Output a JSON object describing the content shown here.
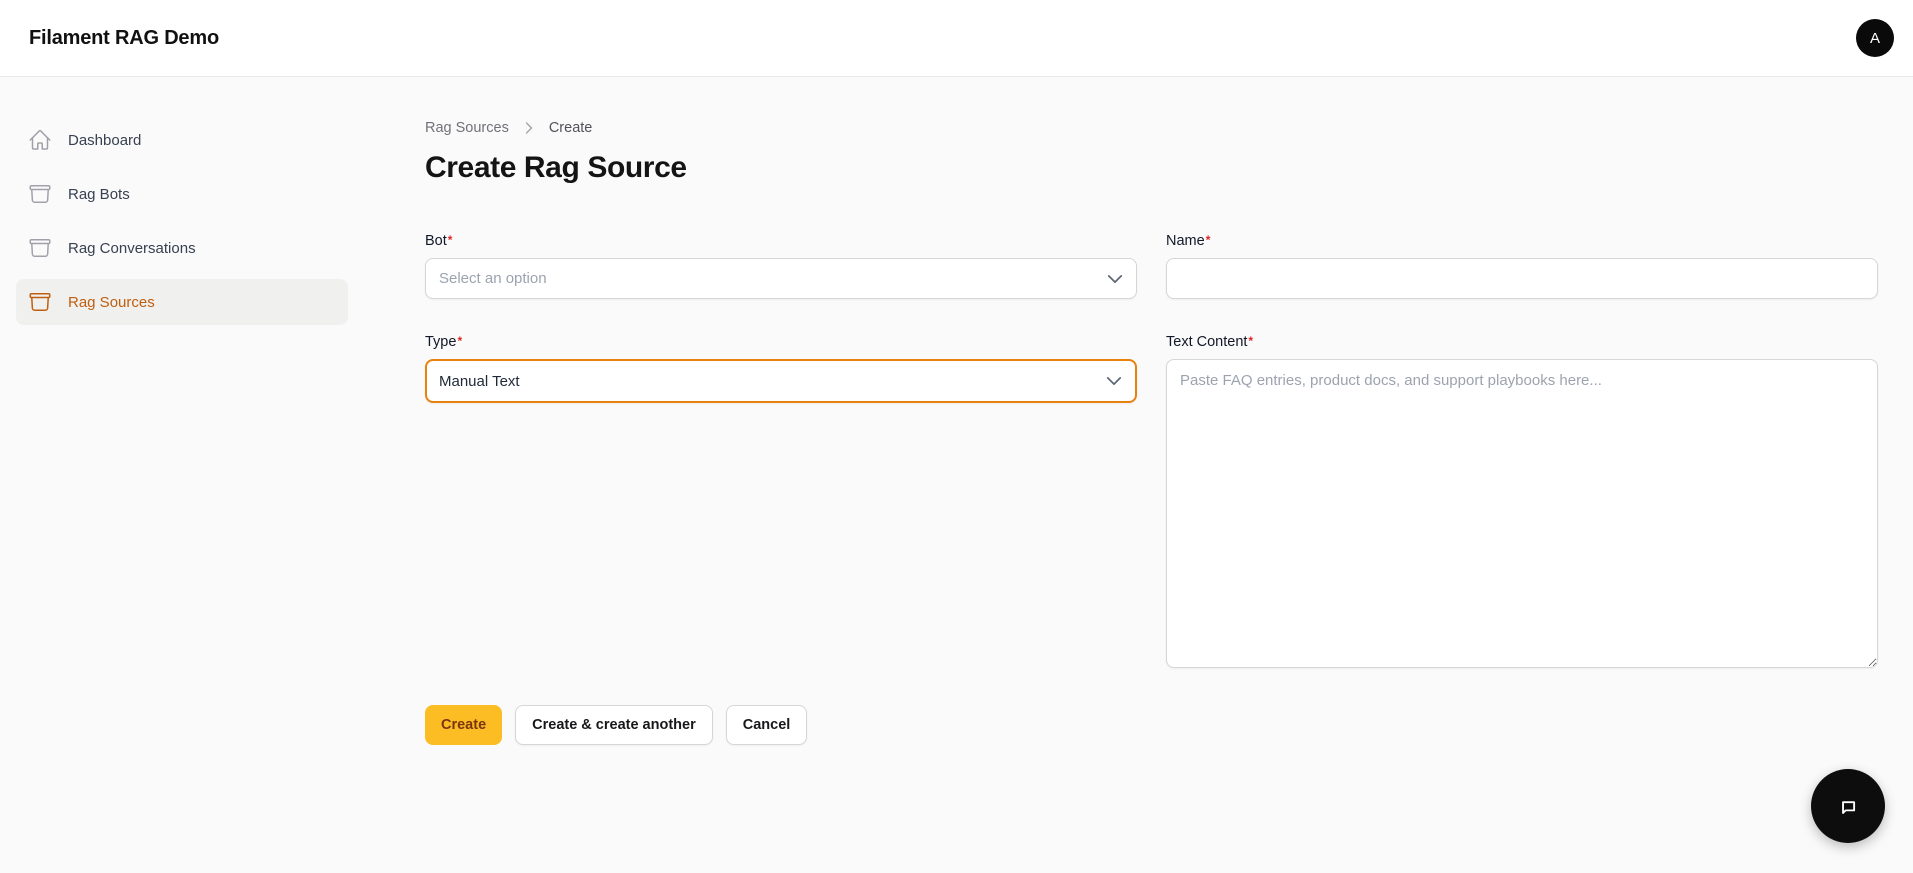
{
  "topbar": {
    "title": "Filament RAG Demo",
    "avatar_initial": "A"
  },
  "sidebar": {
    "items": [
      {
        "label": "Dashboard",
        "icon": "home-icon",
        "active": false
      },
      {
        "label": "Rag Bots",
        "icon": "archive-box-icon",
        "active": false
      },
      {
        "label": "Rag Conversations",
        "icon": "archive-box-icon",
        "active": false
      },
      {
        "label": "Rag Sources",
        "icon": "archive-box-icon",
        "active": true
      }
    ]
  },
  "breadcrumb": {
    "parent": "Rag Sources",
    "current": "Create"
  },
  "page": {
    "title": "Create Rag Source"
  },
  "form": {
    "required_marker": "*",
    "fields": {
      "bot": {
        "label": "Bot",
        "placeholder": "Select an option"
      },
      "name": {
        "label": "Name",
        "value": ""
      },
      "type": {
        "label": "Type",
        "value": "Manual Text"
      },
      "text_content": {
        "label": "Text Content",
        "placeholder": "Paste FAQ entries, product docs, and support playbooks here..."
      }
    },
    "actions": {
      "create": "Create",
      "create_another": "Create & create another",
      "cancel": "Cancel"
    }
  },
  "colors": {
    "primary_focus_ring": "#e8820f",
    "primary_button_bg": "#fbbd23",
    "primary_button_text": "#7b350f",
    "active_nav": "#c05e10",
    "required_asterisk": "#dc2626",
    "page_background": "#fafafa",
    "avatar_background": "#0a0a0a"
  }
}
